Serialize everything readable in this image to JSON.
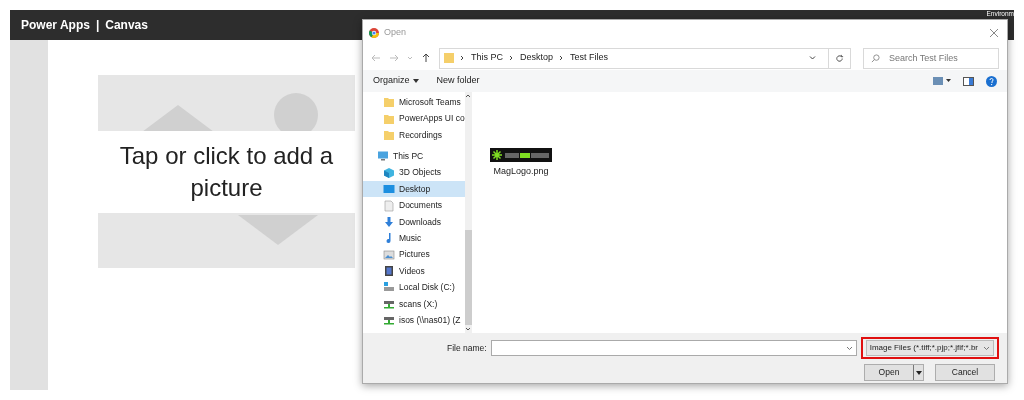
{
  "app_bar": {
    "title": "Power Apps",
    "separator": "|",
    "subtitle": "Canvas",
    "environment": "Environm"
  },
  "image_control": {
    "prompt": "Tap or click to add a picture"
  },
  "dialog": {
    "title": "Open",
    "breadcrumb": [
      "This PC",
      "Desktop",
      "Test Files"
    ],
    "search": {
      "placeholder": "Search Test Files"
    },
    "toolbar": [
      {
        "label": "Organize",
        "kind": "menu"
      },
      {
        "label": "New folder",
        "kind": "plain"
      }
    ],
    "nav": [
      {
        "label": "Microsoft Teams",
        "kind": "folder",
        "selected": false
      },
      {
        "label": "PowerApps UI co",
        "kind": "folder",
        "selected": false
      },
      {
        "label": "Recordings",
        "kind": "folder",
        "selected": false
      },
      {
        "label": "This PC",
        "kind": "pc",
        "selected": false
      },
      {
        "label": "3D Objects",
        "kind": "cube",
        "selected": false
      },
      {
        "label": "Desktop",
        "kind": "desktop",
        "selected": true
      },
      {
        "label": "Documents",
        "kind": "document",
        "selected": false
      },
      {
        "label": "Downloads",
        "kind": "download",
        "selected": false
      },
      {
        "label": "Music",
        "kind": "music",
        "selected": false
      },
      {
        "label": "Pictures",
        "kind": "pictures",
        "selected": false
      },
      {
        "label": "Videos",
        "kind": "video",
        "selected": false
      },
      {
        "label": "Local Disk (C:)",
        "kind": "disk",
        "selected": false
      },
      {
        "label": "scans (X:)",
        "kind": "network",
        "selected": false
      },
      {
        "label": "isos (\\\\nas01) (Z",
        "kind": "network",
        "selected": false
      }
    ],
    "files": [
      {
        "name": "MagLogo.png"
      }
    ],
    "file_name": {
      "label": "File name:"
    },
    "file_type": {
      "value": "Image Files (*.tiff;*.pjp;*.jfif;*.br",
      "highlighted": true
    },
    "buttons": [
      {
        "label": "Open",
        "kind": "split"
      },
      {
        "label": "Cancel",
        "kind": "plain"
      }
    ]
  }
}
